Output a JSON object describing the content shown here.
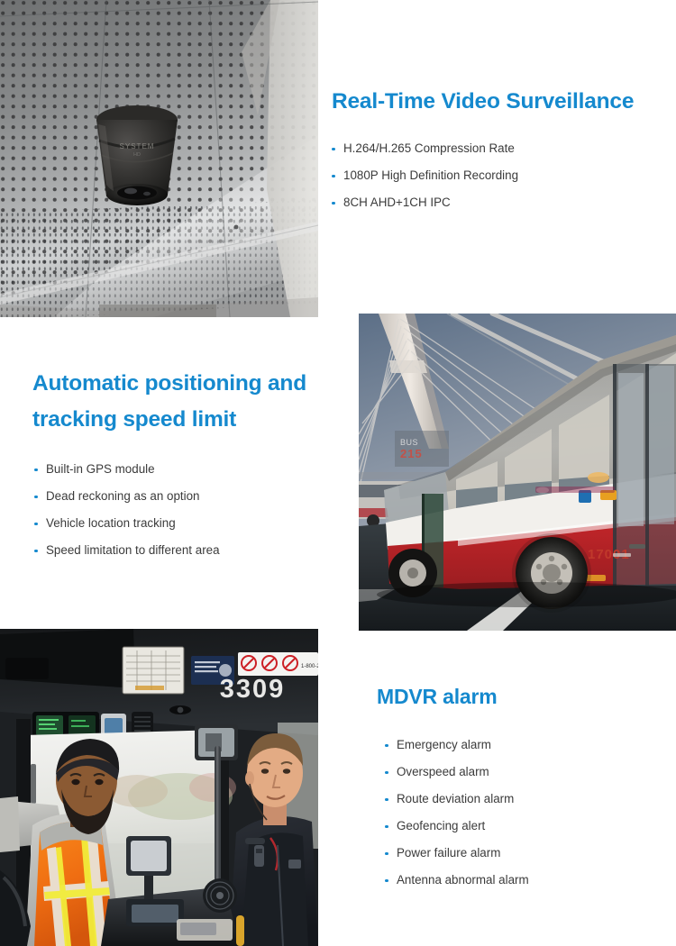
{
  "page": {
    "background": "#ffffff",
    "accent_color": "#1589ce",
    "body_text_color": "#3b3b3b"
  },
  "sections": [
    {
      "id": "video",
      "title": "Real-Time Video Surveillance",
      "bullets": [
        "H.264/H.265 Compression Rate",
        "1080P High Definition Recording",
        "8CH AHD+1CH IPC"
      ]
    },
    {
      "id": "gps",
      "title_line1": "Automatic positioning and",
      "title_line2": "tracking speed limit",
      "bullets": [
        "Built-in GPS module",
        "Dead reckoning as an option",
        "Vehicle location tracking",
        "Speed limitation to different area"
      ]
    },
    {
      "id": "alarm",
      "title": "MDVR alarm",
      "bullets": [
        "Emergency alarm",
        "Overspeed alarm",
        "Route deviation alarm",
        "Geofencing alert",
        "Power failure alarm",
        "Antenna abnormal alarm"
      ]
    }
  ],
  "photos": {
    "ceiling_camera": {
      "name": "ceiling-dome-camera-photo",
      "description": "Black dome surveillance camera mounted on a perforated grey bus ceiling panel"
    },
    "bus_bridge": {
      "name": "bus-on-bridge-photo",
      "description": "White and red city bus driving across a cable-stayed bridge",
      "fleet_number": "17001",
      "route_sign": "215"
    },
    "bus_cabin": {
      "name": "bus-cabin-photo",
      "description": "Bus driver in hi-viz vest and transit officer inside a bus cab",
      "vehicle_number": "3309",
      "notice_phone": "1-800-2"
    }
  }
}
